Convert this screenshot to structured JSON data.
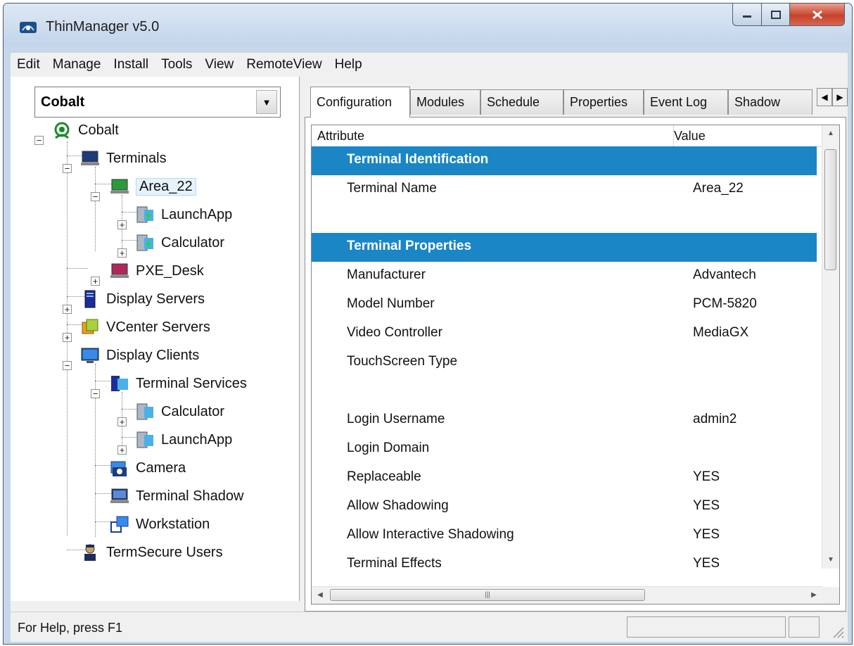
{
  "window": {
    "title": "ThinManager v5.0"
  },
  "menu": [
    "Edit",
    "Manage",
    "Install",
    "Tools",
    "View",
    "RemoteView",
    "Help"
  ],
  "combo": {
    "value": "Cobalt"
  },
  "tree": {
    "root": "Cobalt",
    "terminals": "Terminals",
    "area22": "Area_22",
    "launchapp1": "LaunchApp",
    "calculator1": "Calculator",
    "pxedesk": "PXE_Desk",
    "displayservers": "Display Servers",
    "vcenter": "VCenter Servers",
    "displayclients": "Display Clients",
    "termservices": "Terminal Services",
    "calculator2": "Calculator",
    "launchapp2": "LaunchApp",
    "camera": "Camera",
    "termshadow": "Terminal Shadow",
    "workstation": "Workstation",
    "termsecure": "TermSecure Users"
  },
  "tabs": [
    "Configuration",
    "Modules",
    "Schedule",
    "Properties",
    "Event Log",
    "Shadow"
  ],
  "grid": {
    "col_attribute": "Attribute",
    "col_value": "Value",
    "rows": [
      {
        "attr": "Terminal Identification",
        "value": "",
        "section": true
      },
      {
        "attr": "Terminal Name",
        "value": "Area_22"
      },
      {
        "attr": "",
        "value": ""
      },
      {
        "attr": "Terminal Properties",
        "value": "",
        "section": true
      },
      {
        "attr": "Manufacturer",
        "value": "Advantech"
      },
      {
        "attr": "Model Number",
        "value": "PCM-5820"
      },
      {
        "attr": "Video Controller",
        "value": "MediaGX"
      },
      {
        "attr": "TouchScreen Type",
        "value": ""
      },
      {
        "attr": "",
        "value": ""
      },
      {
        "attr": "Login Username",
        "value": "admin2"
      },
      {
        "attr": "Login Domain",
        "value": ""
      },
      {
        "attr": "Replaceable",
        "value": "YES"
      },
      {
        "attr": "Allow Shadowing",
        "value": "YES"
      },
      {
        "attr": "Allow Interactive Shadowing",
        "value": "YES"
      },
      {
        "attr": "Terminal Effects",
        "value": "YES"
      }
    ]
  },
  "status": {
    "text": "For Help, press F1"
  },
  "colors": {
    "section": "#1a86c6",
    "window_frame": "#c7d7ea"
  }
}
